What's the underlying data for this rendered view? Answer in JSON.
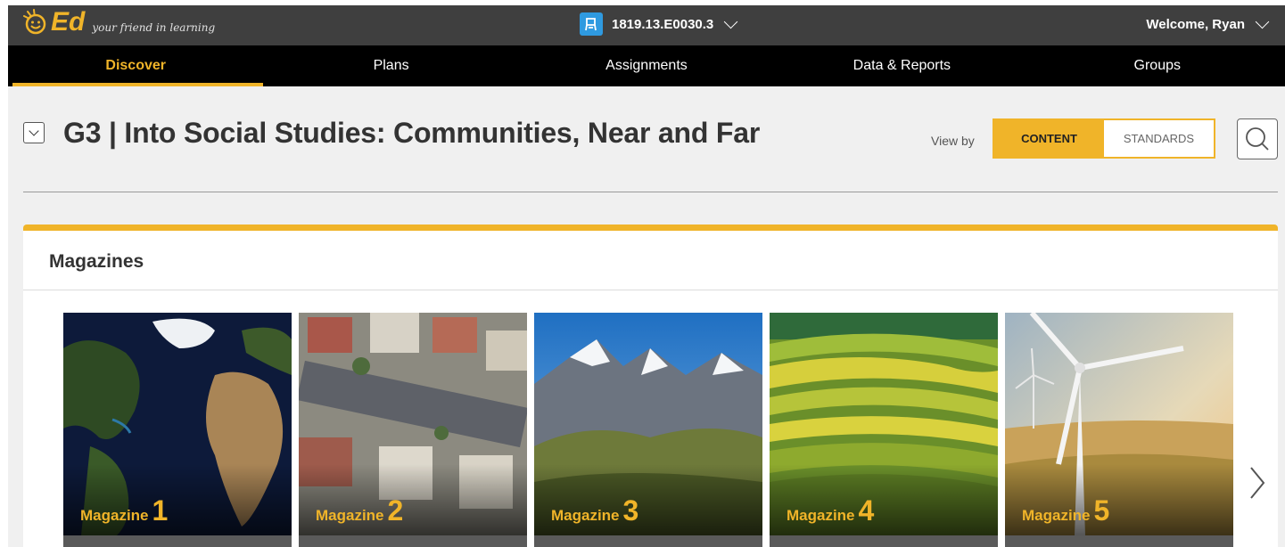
{
  "brand": {
    "logo_text": "Ed",
    "tagline": "your friend in learning",
    "accent_color": "#f0b429"
  },
  "header": {
    "class_selector": "1819.13.E0030.3",
    "welcome": "Welcome, Ryan"
  },
  "nav": {
    "items": [
      {
        "label": "Discover",
        "active": true
      },
      {
        "label": "Plans",
        "active": false
      },
      {
        "label": "Assignments",
        "active": false
      },
      {
        "label": "Data & Reports",
        "active": false
      },
      {
        "label": "Groups",
        "active": false
      }
    ]
  },
  "main": {
    "title": "G3 | Into Social Studies: Communities, Near and Far",
    "view_by_label": "View by",
    "view_options": [
      {
        "label": "CONTENT",
        "selected": true
      },
      {
        "label": "STANDARDS",
        "selected": false
      }
    ]
  },
  "magazines": {
    "heading": "Magazines",
    "cards": [
      {
        "label": "Magazine",
        "number": "1",
        "image": "world-map-satellite"
      },
      {
        "label": "Magazine",
        "number": "2",
        "image": "suburban-houses-aerial"
      },
      {
        "label": "Magazine",
        "number": "3",
        "image": "snowy-mountains"
      },
      {
        "label": "Magazine",
        "number": "4",
        "image": "rice-terraces"
      },
      {
        "label": "Magazine",
        "number": "5",
        "image": "wind-turbine"
      }
    ]
  },
  "icons": {
    "class_icon": "classroom-icon",
    "search": "search-icon",
    "next": "chevron-right-icon",
    "collapse": "chevron-down-icon"
  }
}
